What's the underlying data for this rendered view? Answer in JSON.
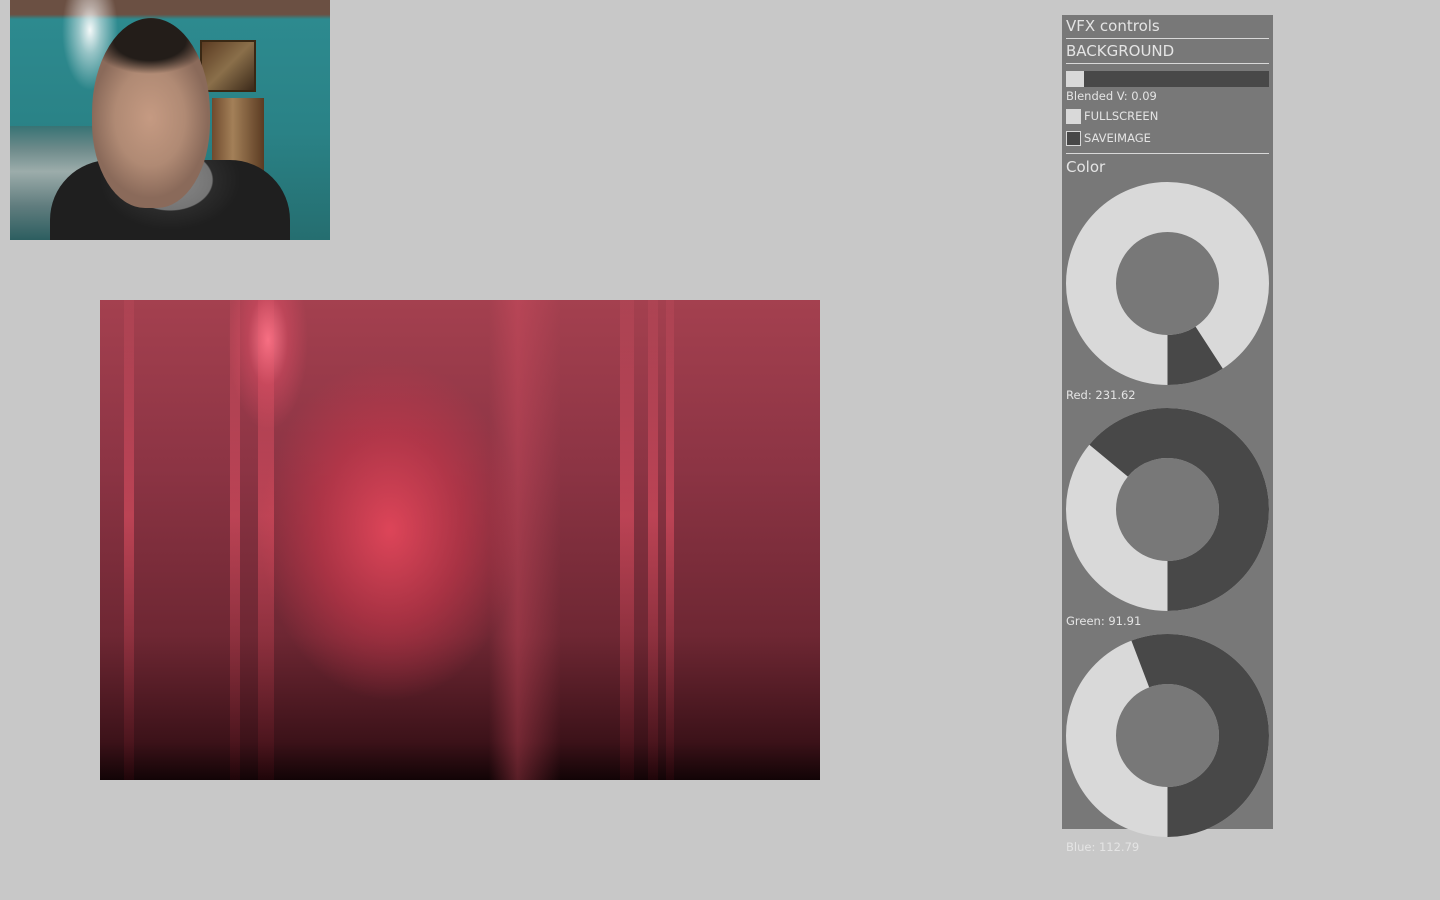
{
  "panel": {
    "title": "VFX controls",
    "background_section": "BACKGROUND",
    "blend_slider": {
      "label": "Blended V: 0.09",
      "value": 0.09
    },
    "toggles": [
      {
        "label": "FULLSCREEN",
        "checked": true
      },
      {
        "label": "SAVEIMAGE",
        "checked": false
      }
    ],
    "color_section": "Color",
    "knobs": [
      {
        "label": "Red: 231.62",
        "value": 231.62,
        "max": 255
      },
      {
        "label": "Green: 91.91",
        "value": 91.91,
        "max": 255
      },
      {
        "label": "Blue: 112.79",
        "value": 112.79,
        "max": 255
      }
    ]
  },
  "colors": {
    "background": "#c8c8c8",
    "panel": "#787878",
    "control_light": "#d9d9d9",
    "control_dark": "#484848",
    "text": "#e4e4e4"
  }
}
